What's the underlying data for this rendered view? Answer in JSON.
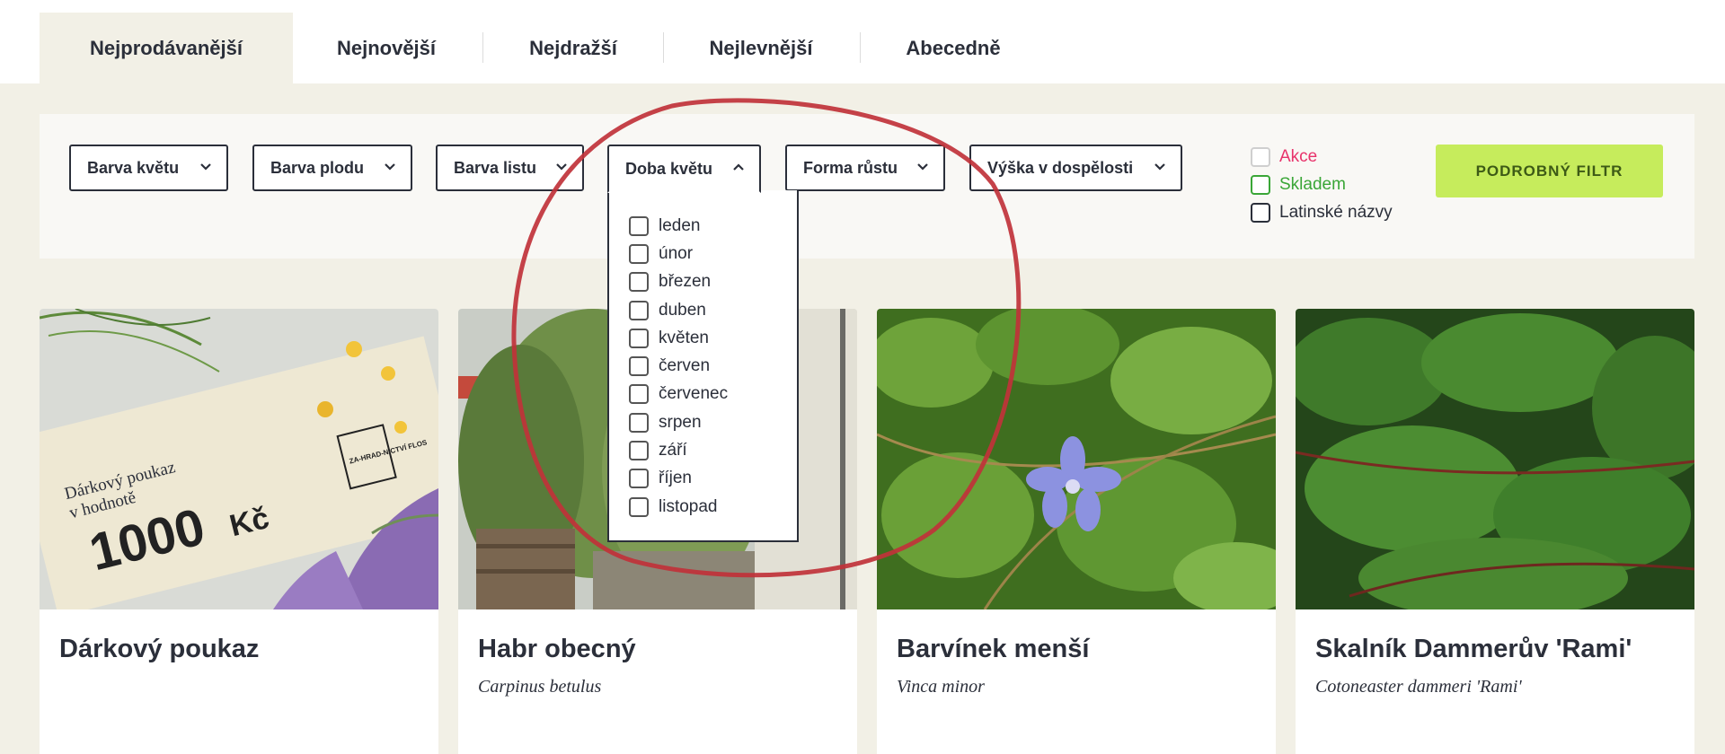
{
  "tabs": [
    {
      "label": "Nejprodávanější",
      "active": true
    },
    {
      "label": "Nejnovější"
    },
    {
      "label": "Nejdražší"
    },
    {
      "label": "Nejlevnější"
    },
    {
      "label": "Abecedně"
    }
  ],
  "filters": {
    "dropdowns": [
      {
        "label": "Barva květu"
      },
      {
        "label": "Barva plodu"
      },
      {
        "label": "Barva listu"
      },
      {
        "label": "Doba květu",
        "open": true
      },
      {
        "label": "Forma růstu"
      },
      {
        "label": "Výška v dospělosti"
      }
    ],
    "open_menu_items": [
      "leden",
      "únor",
      "březen",
      "duben",
      "květen",
      "červen",
      "červenec",
      "srpen",
      "září",
      "říjen",
      "listopad"
    ],
    "checkboxes": [
      {
        "label": "Akce",
        "color": "#e8336b"
      },
      {
        "label": "Skladem",
        "color": "#3aa637"
      },
      {
        "label": "Latinské názvy",
        "color": "#2b2f3a"
      }
    ],
    "detail_button": "PODROBNÝ FILTR"
  },
  "products": [
    {
      "name": "Dárkový poukaz",
      "latin": "",
      "voucher": {
        "line1": "Dárkový poukaz",
        "line2": "v hodnotě",
        "amount": "1000",
        "currency": "Kč",
        "logo": "ZA-HRAD-NICTVÍ FLOS"
      }
    },
    {
      "name": "Habr obecný",
      "latin": "Carpinus betulus"
    },
    {
      "name": "Barvínek menší",
      "latin": "Vinca minor"
    },
    {
      "name": "Skalník Dammerův 'Rami'",
      "latin": "Cotoneaster dammeri 'Rami'"
    }
  ],
  "colors": {
    "accent_button": "#c6ec5c",
    "annotation": "#c0323a",
    "background": "#f2f0e6"
  },
  "icons": {
    "dropdown": "chevron-down-icon",
    "dropdown_open": "chevron-up-icon"
  }
}
